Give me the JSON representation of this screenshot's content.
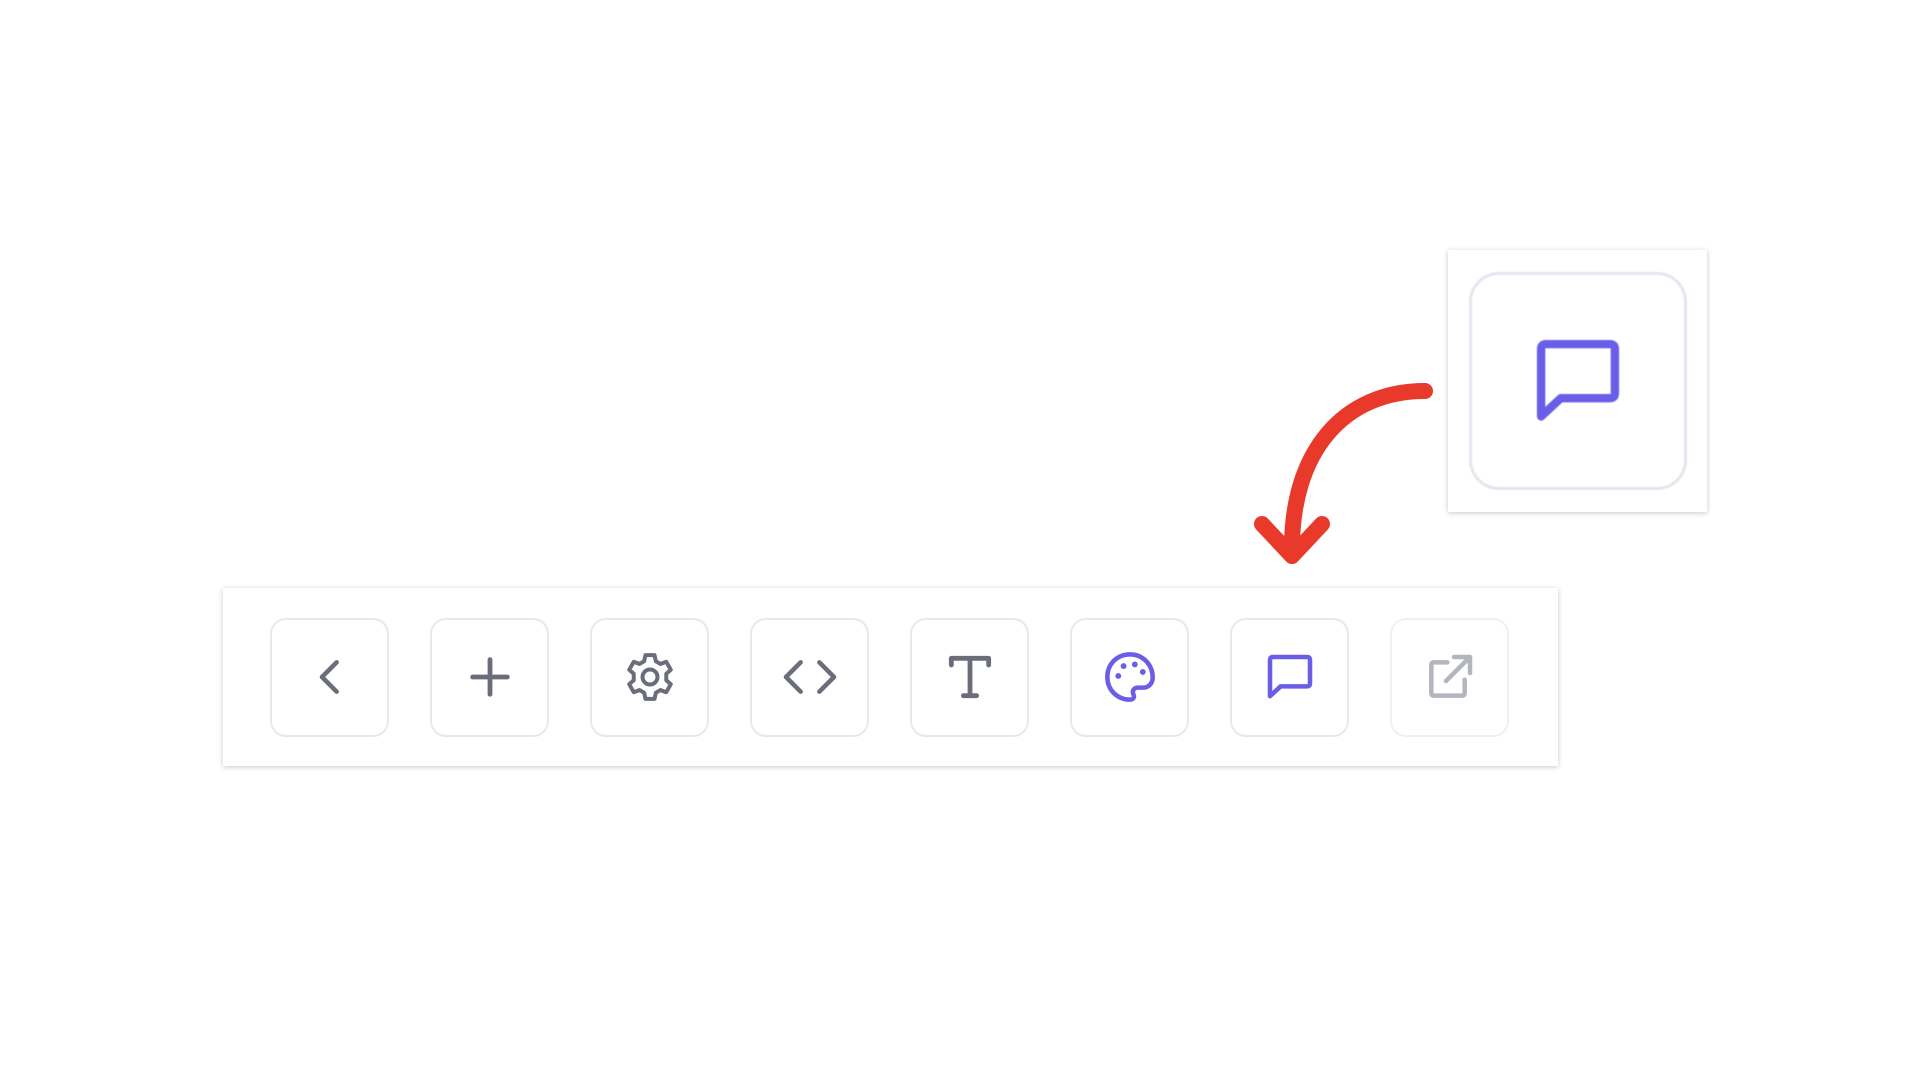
{
  "toolbar": {
    "buttons": [
      {
        "icon": "chevron-left-icon",
        "color": "#6b6e7a"
      },
      {
        "icon": "plus-icon",
        "color": "#6b6e7a"
      },
      {
        "icon": "gear-icon",
        "color": "#6b6e7a"
      },
      {
        "icon": "code-icon",
        "color": "#6b6e7a"
      },
      {
        "icon": "text-icon",
        "color": "#6b6e7a"
      },
      {
        "icon": "palette-icon",
        "color": "#6a5ee8"
      },
      {
        "icon": "comment-icon",
        "color": "#6a5ee8"
      },
      {
        "icon": "external-link-icon",
        "color": "#b4b6bd"
      }
    ]
  },
  "zoom_callout": {
    "icon": "comment-icon",
    "color": "#6a5ee8"
  },
  "annotation": {
    "arrow_color": "#e8392b"
  }
}
